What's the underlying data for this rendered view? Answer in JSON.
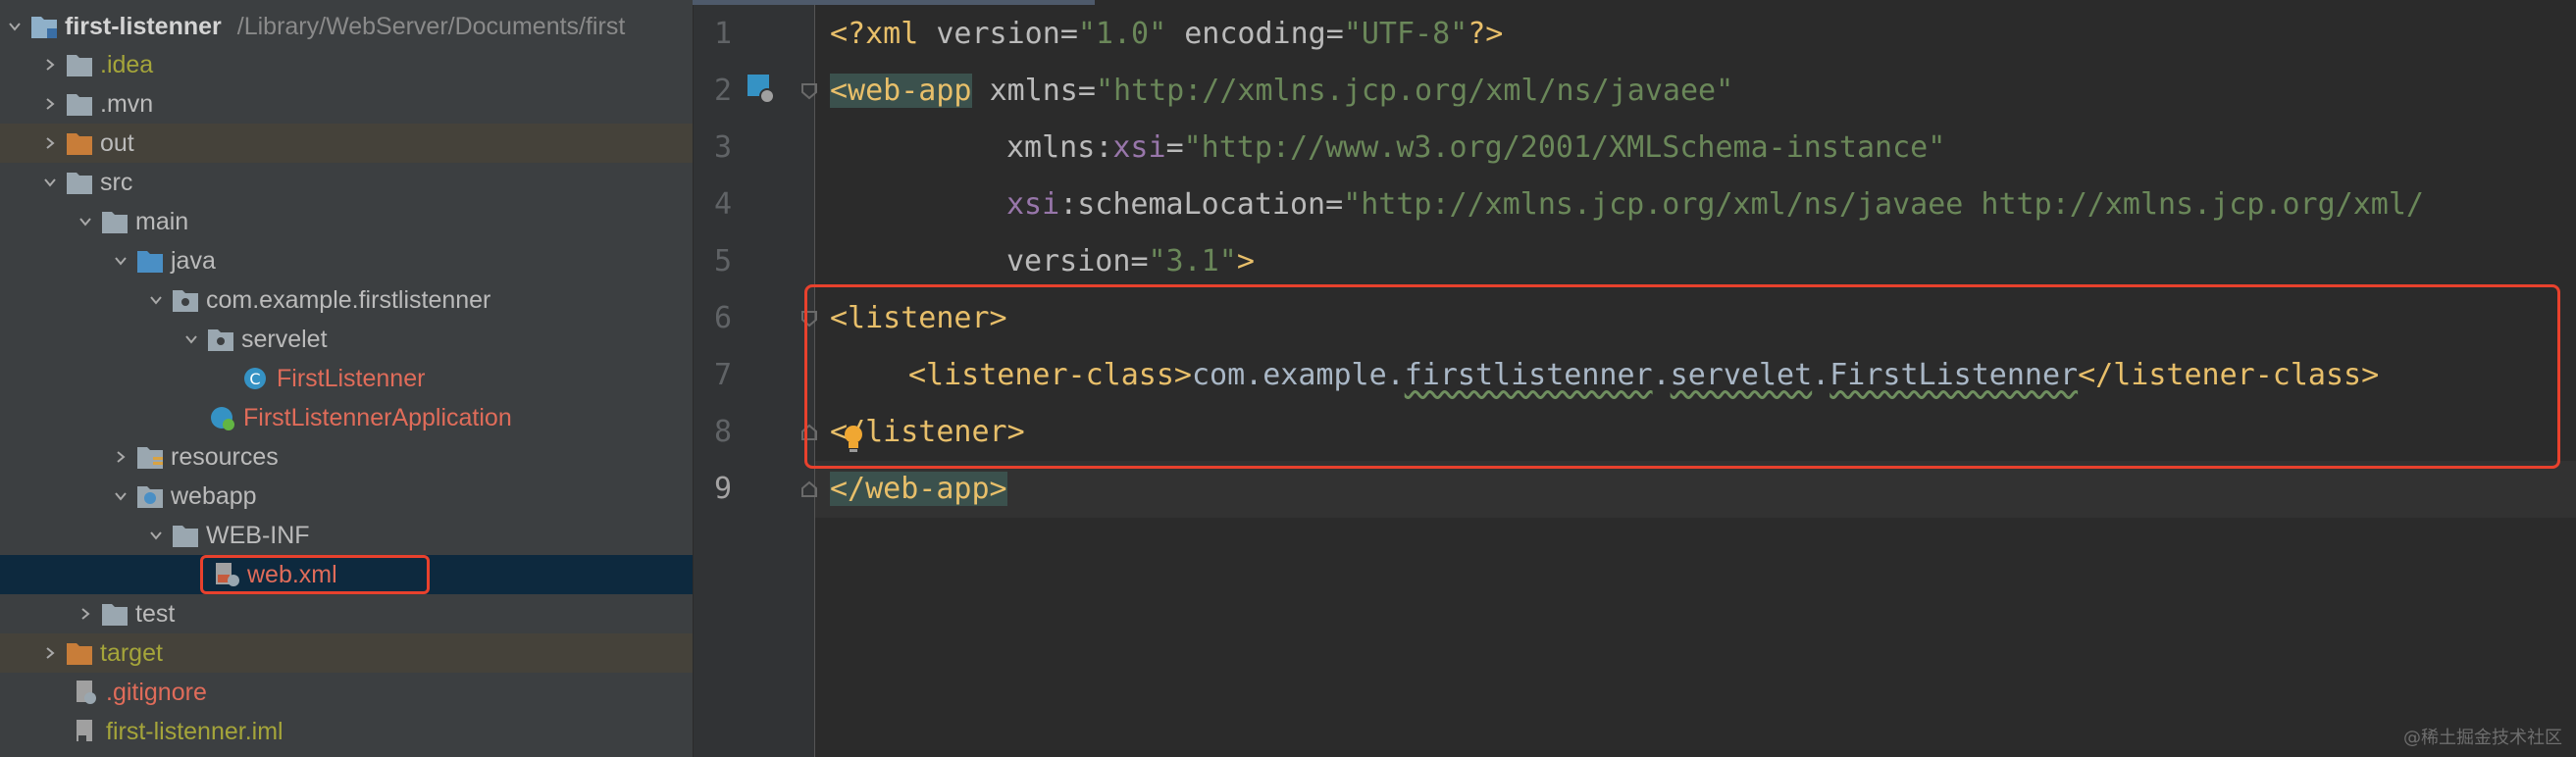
{
  "project": {
    "name": "first-listenner",
    "path": "/Library/WebServer/Documents/first",
    "items": [
      {
        "label": ".idea"
      },
      {
        "label": ".mvn"
      },
      {
        "label": "out"
      },
      {
        "label": "src"
      },
      {
        "label": "main"
      },
      {
        "label": "java"
      },
      {
        "label": "com.example.firstlistenner"
      },
      {
        "label": "servelet"
      },
      {
        "label": "FirstListenner"
      },
      {
        "label": "FirstListennerApplication"
      },
      {
        "label": "resources"
      },
      {
        "label": "webapp"
      },
      {
        "label": "WEB-INF"
      },
      {
        "label": "web.xml"
      },
      {
        "label": "test"
      },
      {
        "label": "target"
      },
      {
        "label": ".gitignore"
      },
      {
        "label": "first-listenner.iml"
      }
    ]
  },
  "editor": {
    "line_numbers": [
      "1",
      "2",
      "3",
      "4",
      "5",
      "6",
      "7",
      "8",
      "9"
    ],
    "current_line": "9",
    "tokens": {
      "l1": [
        "<?xml ",
        "version",
        "=",
        "\"1.0\"",
        " ",
        "encoding",
        "=",
        "\"UTF-8\"",
        "?>"
      ],
      "l2": [
        "<web-app",
        " ",
        "xmlns",
        "=",
        "\"http://xmlns.jcp.org/xml/ns/javaee\""
      ],
      "l3": [
        "xmlns",
        ":",
        "xsi",
        "=",
        "\"http://www.w3.org/2001/XMLSchema-instance\""
      ],
      "l4": [
        "xsi",
        ":",
        "schemaLocation",
        "=",
        "\"http://xmlns.jcp.org/xml/ns/javaee http://xmlns.jcp.org/xml/"
      ],
      "l5": [
        "version",
        "=",
        "\"3.1\"",
        ">"
      ],
      "l6": [
        "<listener>"
      ],
      "l7": [
        "<listener-class>",
        "com.example.",
        "firstlistenner",
        ".",
        "servelet",
        ".",
        "FirstListenner",
        "</listener-class>"
      ],
      "l8": [
        "</listener>"
      ],
      "l9": [
        "</web-app>"
      ]
    }
  },
  "watermark": "@稀土掘金技术社区",
  "colors": {
    "tree_bg": "#3c3f41",
    "editor_bg": "#2b2b2b",
    "tag": "#e8bf6a",
    "string": "#6a8759",
    "namespace": "#9876aa",
    "highlight_box": "#e8412d",
    "selection": "#0d293e"
  }
}
